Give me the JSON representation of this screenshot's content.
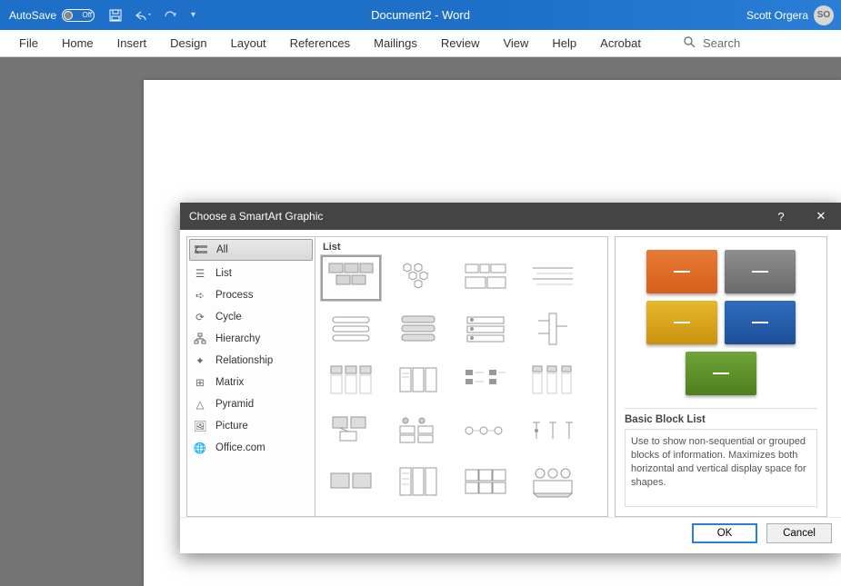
{
  "titlebar": {
    "autosave_label": "AutoSave",
    "autosave_state": "Off",
    "doc_title": "Document2  -  Word",
    "user_name": "Scott Orgera",
    "user_initials": "SO"
  },
  "ribbon": {
    "tabs": [
      "File",
      "Home",
      "Insert",
      "Design",
      "Layout",
      "References",
      "Mailings",
      "Review",
      "View",
      "Help",
      "Acrobat"
    ],
    "search_placeholder": "Search"
  },
  "dialog": {
    "title": "Choose a SmartArt Graphic",
    "categories": [
      {
        "label": "All",
        "icon": "all-icon",
        "selected": true
      },
      {
        "label": "List",
        "icon": "list-icon"
      },
      {
        "label": "Process",
        "icon": "process-icon"
      },
      {
        "label": "Cycle",
        "icon": "cycle-icon"
      },
      {
        "label": "Hierarchy",
        "icon": "hierarchy-icon"
      },
      {
        "label": "Relationship",
        "icon": "relationship-icon"
      },
      {
        "label": "Matrix",
        "icon": "matrix-icon"
      },
      {
        "label": "Pyramid",
        "icon": "pyramid-icon"
      },
      {
        "label": "Picture",
        "icon": "picture-icon"
      },
      {
        "label": "Office.com",
        "icon": "globe-icon"
      }
    ],
    "grid_heading": "List",
    "preview": {
      "name": "Basic Block List",
      "description": "Use to show non-sequential or grouped blocks of information. Maximizes both horizontal and vertical display space for shapes."
    },
    "ok_label": "OK",
    "cancel_label": "Cancel"
  }
}
